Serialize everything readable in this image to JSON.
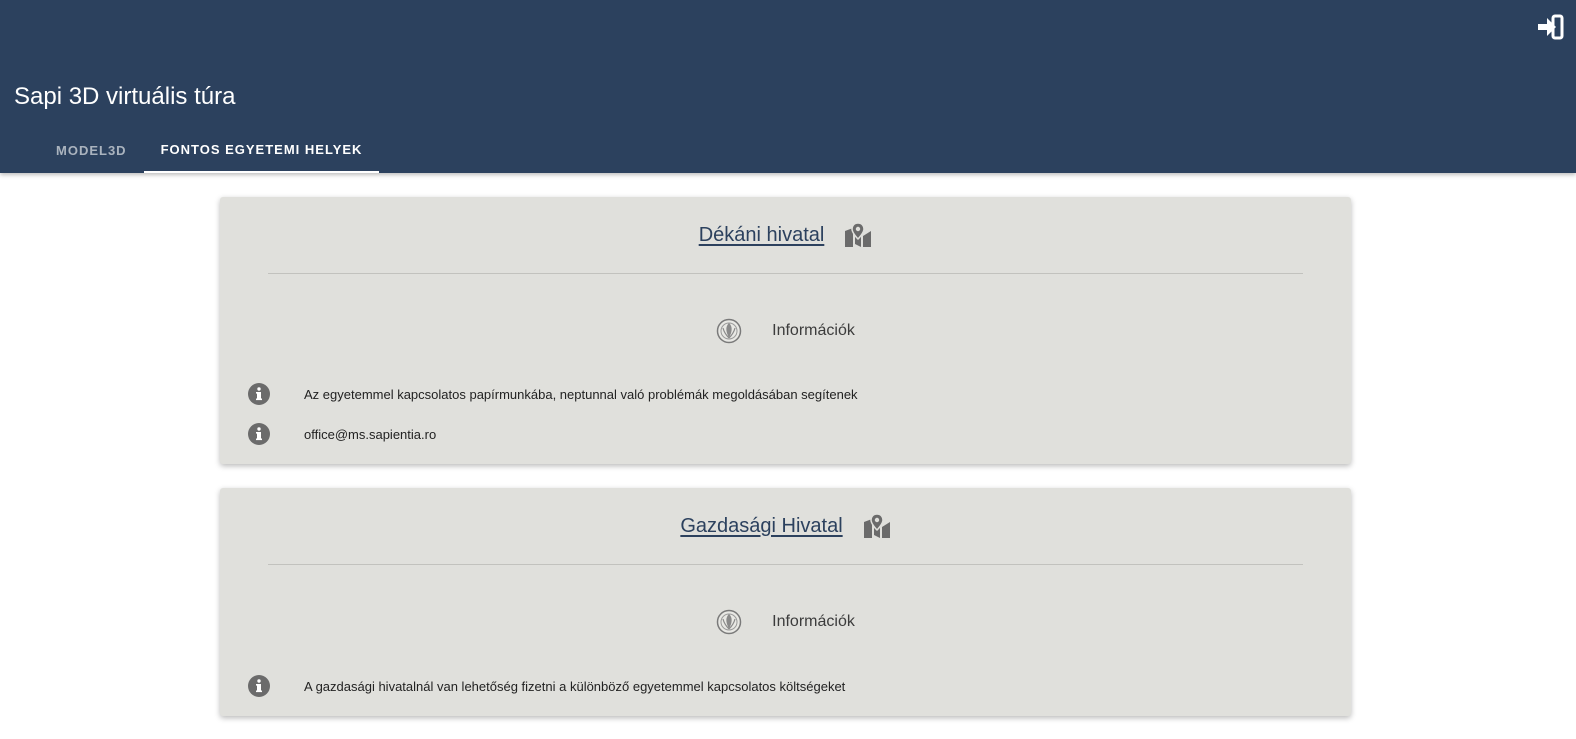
{
  "header": {
    "title": "Sapi 3D virtuális túra",
    "login_icon": "sign-in-icon",
    "tabs": [
      {
        "label": "MODEL3D",
        "active": false
      },
      {
        "label": "FONTOS EGYETEMI HELYEK",
        "active": true
      }
    ]
  },
  "colors": {
    "header_bg": "#2c415e",
    "card_bg": "#e0e0dc",
    "title_link": "#2c415e",
    "icon_gray": "#6b6b6b"
  },
  "cards": [
    {
      "title": "Dékáni hivatal",
      "map_icon": "map-marker-icon",
      "info_label": "Információk",
      "items": [
        {
          "icon": "info-icon",
          "text": "Az egyetemmel kapcsolatos papírmunkába, neptunnal való problémák megoldásában segítenek"
        },
        {
          "icon": "info-icon",
          "text": "office@ms.sapientia.ro"
        }
      ]
    },
    {
      "title": "Gazdasági Hivatal",
      "map_icon": "map-marker-icon",
      "info_label": "Információk",
      "items": [
        {
          "icon": "info-icon",
          "text": "A gazdasági hivatalnál van lehetőség fizetni a különböző egyetemmel kapcsolatos költségeket"
        }
      ]
    }
  ]
}
